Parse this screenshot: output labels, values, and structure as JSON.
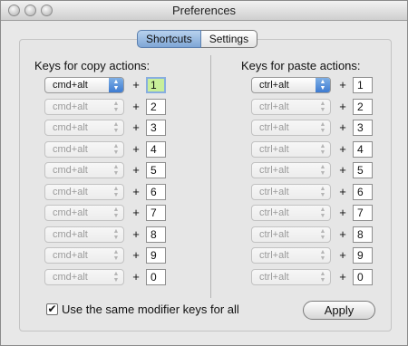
{
  "window": {
    "title": "Preferences"
  },
  "tabs": [
    {
      "label": "Shortcuts",
      "active": true
    },
    {
      "label": "Settings",
      "active": false
    }
  ],
  "copy": {
    "heading": "Keys for copy actions:",
    "rows": [
      {
        "modifier": "cmd+alt",
        "key": "1",
        "enabled": true,
        "focused": true
      },
      {
        "modifier": "cmd+alt",
        "key": "2",
        "enabled": false
      },
      {
        "modifier": "cmd+alt",
        "key": "3",
        "enabled": false
      },
      {
        "modifier": "cmd+alt",
        "key": "4",
        "enabled": false
      },
      {
        "modifier": "cmd+alt",
        "key": "5",
        "enabled": false
      },
      {
        "modifier": "cmd+alt",
        "key": "6",
        "enabled": false
      },
      {
        "modifier": "cmd+alt",
        "key": "7",
        "enabled": false
      },
      {
        "modifier": "cmd+alt",
        "key": "8",
        "enabled": false
      },
      {
        "modifier": "cmd+alt",
        "key": "9",
        "enabled": false
      },
      {
        "modifier": "cmd+alt",
        "key": "0",
        "enabled": false
      }
    ]
  },
  "paste": {
    "heading": "Keys for paste actions:",
    "rows": [
      {
        "modifier": "ctrl+alt",
        "key": "1",
        "enabled": true
      },
      {
        "modifier": "ctrl+alt",
        "key": "2",
        "enabled": false
      },
      {
        "modifier": "ctrl+alt",
        "key": "3",
        "enabled": false
      },
      {
        "modifier": "ctrl+alt",
        "key": "4",
        "enabled": false
      },
      {
        "modifier": "ctrl+alt",
        "key": "5",
        "enabled": false
      },
      {
        "modifier": "ctrl+alt",
        "key": "6",
        "enabled": false
      },
      {
        "modifier": "ctrl+alt",
        "key": "7",
        "enabled": false
      },
      {
        "modifier": "ctrl+alt",
        "key": "8",
        "enabled": false
      },
      {
        "modifier": "ctrl+alt",
        "key": "9",
        "enabled": false
      },
      {
        "modifier": "ctrl+alt",
        "key": "0",
        "enabled": false
      }
    ]
  },
  "plus_symbol": "+",
  "select_arrow_icon": "up-down-arrows-icon",
  "checkbox": {
    "label": "Use the same modifier keys for all",
    "checked": true,
    "mark": "✔"
  },
  "apply_label": "Apply",
  "colors": {
    "active_tab": "#7fa6d6",
    "select_arrow": "#3d7bd1",
    "focused_field": "#c8ef9a"
  }
}
